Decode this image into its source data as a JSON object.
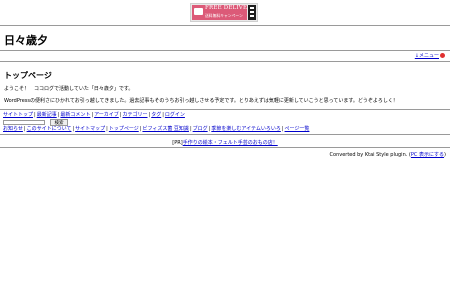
{
  "banner": {
    "title": "FREE DELIVERY",
    "subtitle": "送料無料キャンペーン"
  },
  "site_title": "日々歳夕",
  "menu_label": "↓メニュー",
  "page_heading": "トップページ",
  "paragraphs": [
    "ようこそ！　ココログで活動していた「日々歳夕」です。",
    "WordPressの便利さにひかれてお引っ越してきました。過去記事もそのうちお引っ越しさせる予定です。とりあえずは気軽に更新していこうと思っています。どうぞよろしく！"
  ],
  "nav1": [
    "サイトトップ",
    "最新記事",
    "最新コメント",
    "アーカイブ",
    "カテゴリー",
    "タグ",
    "ログイン"
  ],
  "search": {
    "button_label": "検索"
  },
  "nav2": [
    "お知らせ",
    "このサイトについて",
    "サイトマップ",
    "トップページ",
    "ビフィズス菌 豆知識",
    "ブログ",
    "季節を楽しむアイテムいろいろ",
    "ページ一覧"
  ],
  "pr": {
    "prefix": "[PR]",
    "link": "手作りの絵本・フェルト手芸のおもの店！"
  },
  "footer": {
    "prefix": "Converted by Ktai Style plugin.",
    "link": "PC 表示にする"
  }
}
